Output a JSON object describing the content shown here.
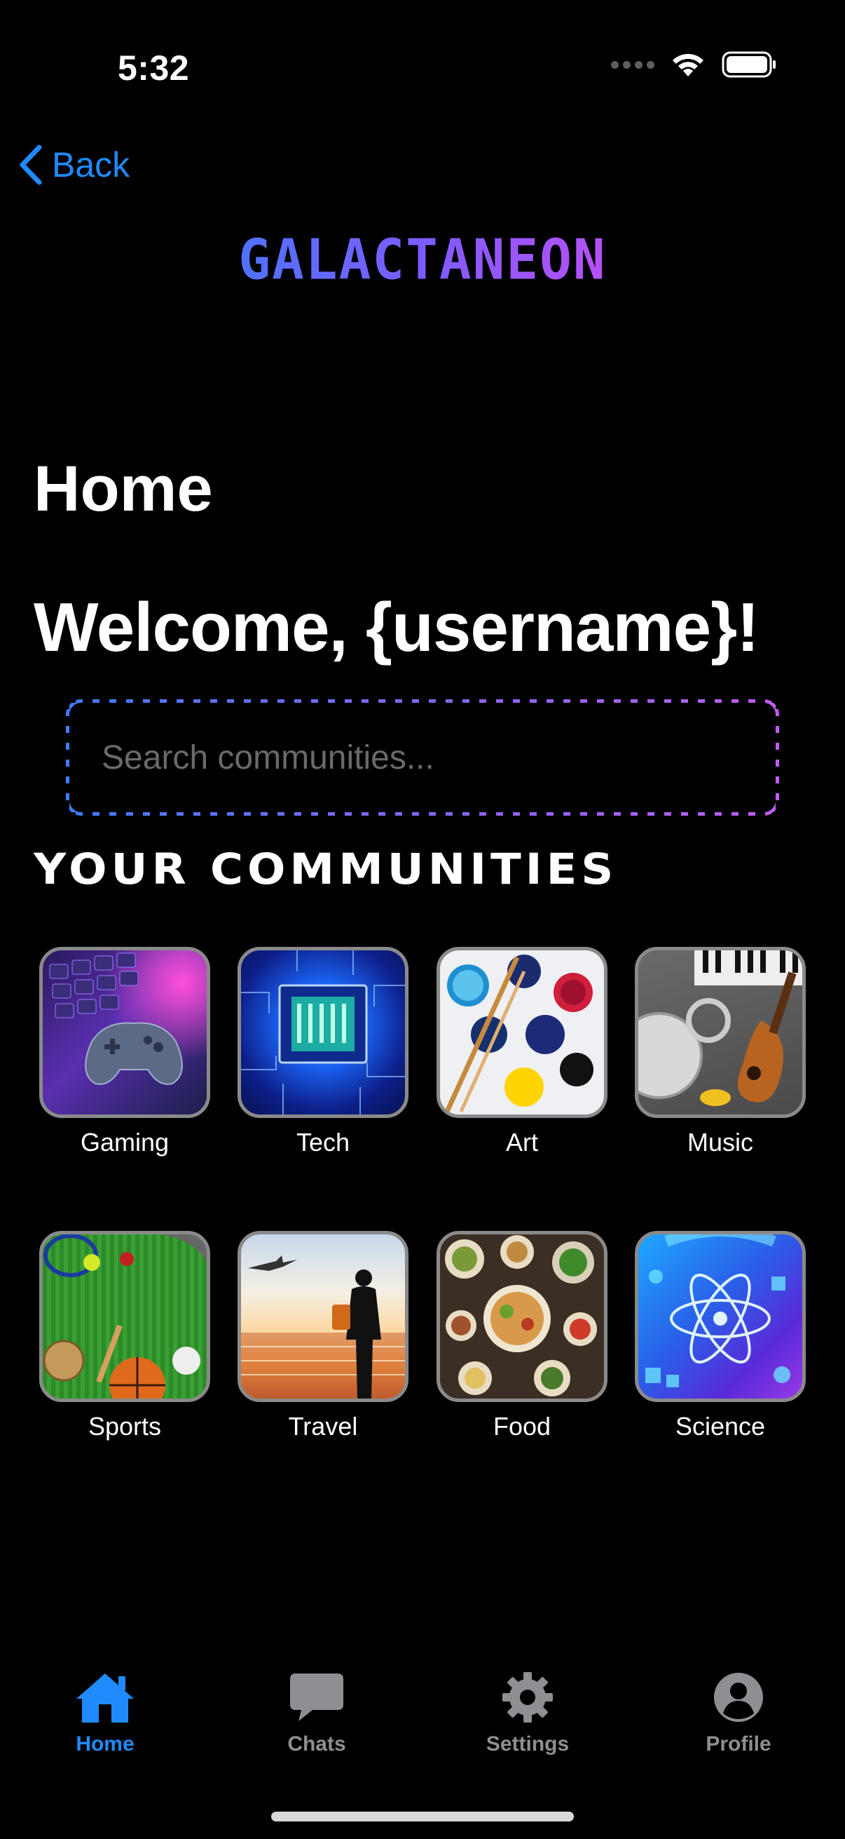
{
  "status_bar": {
    "time": "5:32"
  },
  "nav": {
    "back_label": "Back"
  },
  "logo": {
    "text": "GALACTANEON"
  },
  "page": {
    "title": "Home",
    "welcome": "Welcome, {username}!"
  },
  "search": {
    "placeholder": "Search communities..."
  },
  "communities": {
    "title": "YOUR COMMUNITIES",
    "items": [
      {
        "label": "Gaming",
        "icon": "gamepad-keyboard-image"
      },
      {
        "label": "Tech",
        "icon": "microchip-image"
      },
      {
        "label": "Art",
        "icon": "paint-palette-image"
      },
      {
        "label": "Music",
        "icon": "instruments-image"
      },
      {
        "label": "Sports",
        "icon": "sports-balls-image"
      },
      {
        "label": "Travel",
        "icon": "traveler-airport-image"
      },
      {
        "label": "Food",
        "icon": "food-table-image"
      },
      {
        "label": "Science",
        "icon": "atom-image"
      }
    ]
  },
  "tabbar": {
    "items": [
      {
        "label": "Home",
        "icon": "home-icon",
        "active": true
      },
      {
        "label": "Chats",
        "icon": "chat-bubble-icon",
        "active": false
      },
      {
        "label": "Settings",
        "icon": "gear-icon",
        "active": false
      },
      {
        "label": "Profile",
        "icon": "user-circle-icon",
        "active": false
      }
    ]
  },
  "colors": {
    "background": "#000000",
    "accent_blue": "#1f8bff",
    "gradient_start": "#4f72ff",
    "gradient_end": "#b650f5",
    "inactive_tab": "#8e8e93"
  }
}
